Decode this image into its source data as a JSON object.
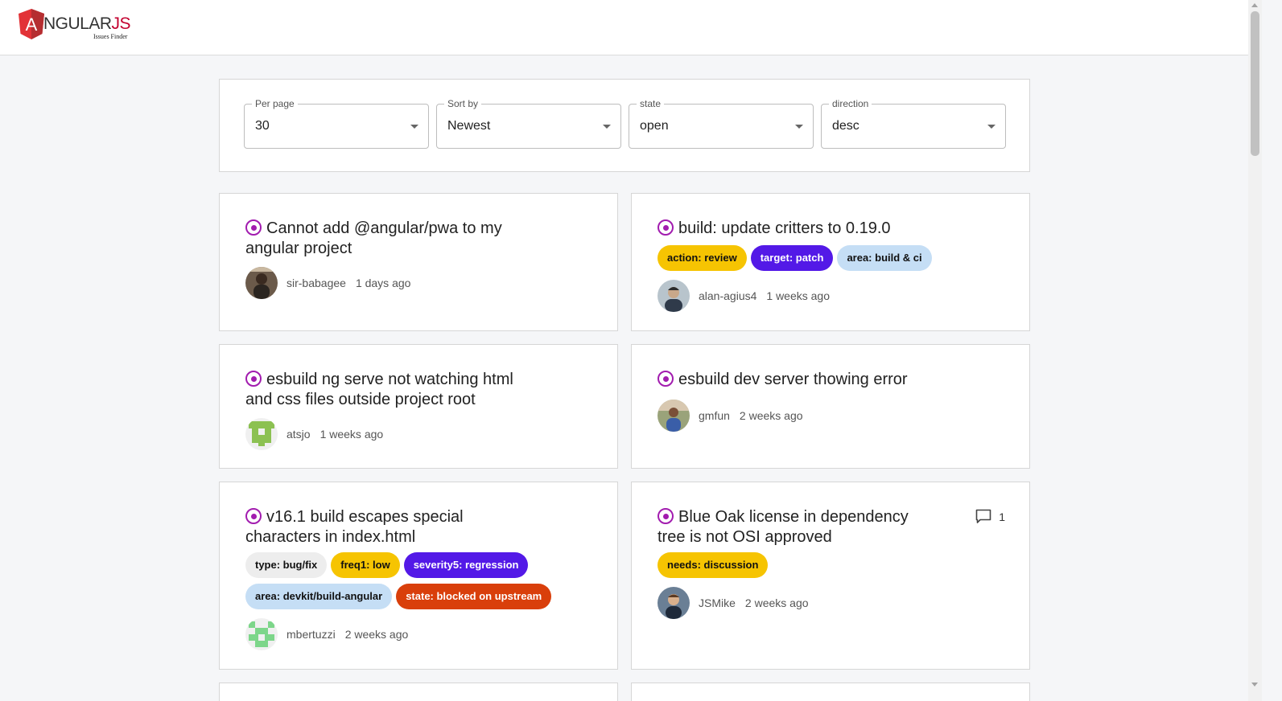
{
  "header": {
    "logo_main": "NGULAR",
    "logo_js": "JS",
    "logo_letter": "A",
    "logo_subtitle": "Issues Finder"
  },
  "filters": [
    {
      "label": "Per page",
      "value": "30"
    },
    {
      "label": "Sort by",
      "value": "Newest"
    },
    {
      "label": "state",
      "value": "open"
    },
    {
      "label": "direction",
      "value": "desc"
    }
  ],
  "colors": {
    "issue_open": "#a21caf",
    "label_yellow": "#f6c402",
    "label_purple": "#5319e7",
    "label_lightblue": "#c5def5",
    "label_gray": "#ededed",
    "label_red": "#d93f0b"
  },
  "issues": [
    {
      "title": "Cannot add @angular/pwa to my angular project",
      "labels": [],
      "author": "sir-babagee",
      "time": "1 days ago"
    },
    {
      "title": "build: update critters to 0.19.0",
      "labels": [
        "action: review",
        "target: patch",
        "area: build & ci"
      ],
      "author": "alan-agius4",
      "time": "1 weeks ago"
    },
    {
      "title": "esbuild ng serve not watching html and css files outside project root",
      "labels": [],
      "author": "atsjo",
      "time": "1 weeks ago"
    },
    {
      "title": "esbuild dev server thowing error",
      "labels": [],
      "author": "gmfun",
      "time": "2 weeks ago"
    },
    {
      "title": "v16.1 build escapes special characters in index.html",
      "labels": [
        "type: bug/fix",
        "freq1: low",
        "severity5: regression",
        "area: devkit/build-angular",
        "state: blocked on upstream"
      ],
      "author": "mbertuzzi",
      "time": "2 weeks ago"
    },
    {
      "title": "Blue Oak license in dependency tree is not OSI approved",
      "labels": [
        "needs: discussion"
      ],
      "author": "JSMike",
      "time": "2 weeks ago",
      "comments": "1"
    }
  ]
}
